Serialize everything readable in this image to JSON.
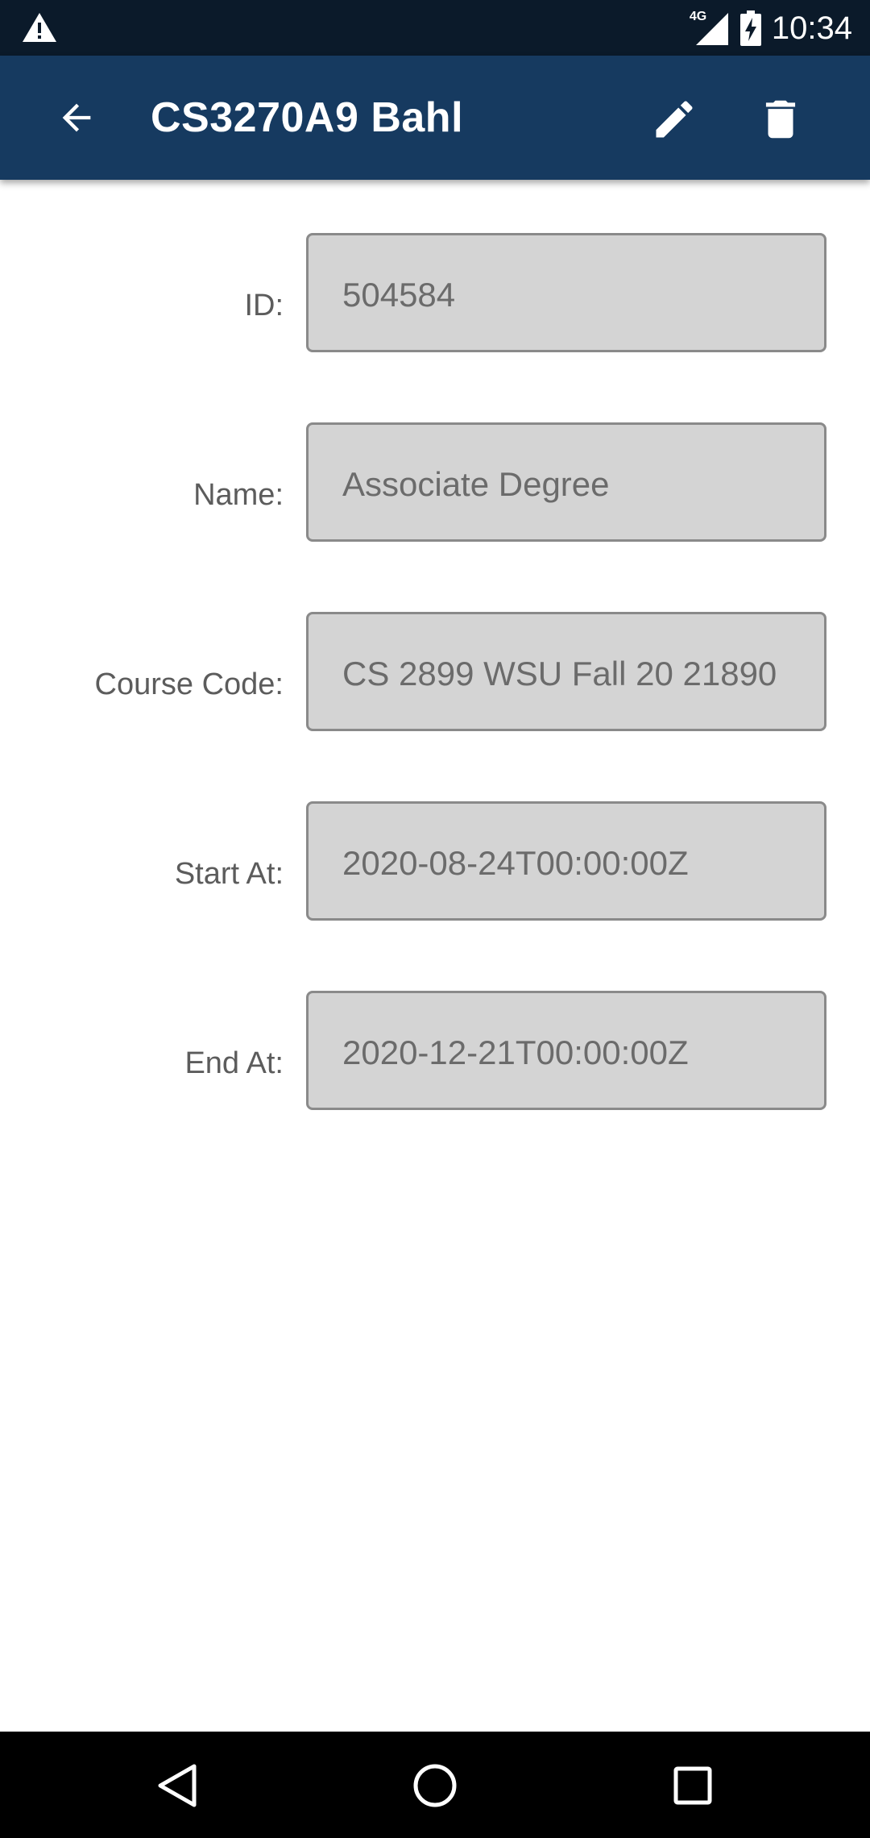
{
  "status_bar": {
    "time": "10:34",
    "network": "4G",
    "icons": [
      "warning-icon",
      "signal-icon",
      "battery-charging-icon"
    ]
  },
  "app_bar": {
    "title": "CS3270A9 Bahl",
    "icons": [
      "back-arrow-icon",
      "pencil-icon",
      "trash-icon"
    ],
    "background": "#163a60"
  },
  "form": {
    "fields": [
      {
        "label": "ID:",
        "value": "504584"
      },
      {
        "label": "Name:",
        "value": "Associate Degree"
      },
      {
        "label": "Course Code:",
        "value": "CS 2899 WSU Fall 20 21890"
      },
      {
        "label": "Start At:",
        "value": "2020-08-24T00:00:00Z"
      },
      {
        "label": "End At:",
        "value": "2020-12-21T00:00:00Z"
      }
    ]
  },
  "nav_bar": {
    "icons": [
      "back-triangle-icon",
      "home-circle-icon",
      "recents-square-icon"
    ]
  }
}
